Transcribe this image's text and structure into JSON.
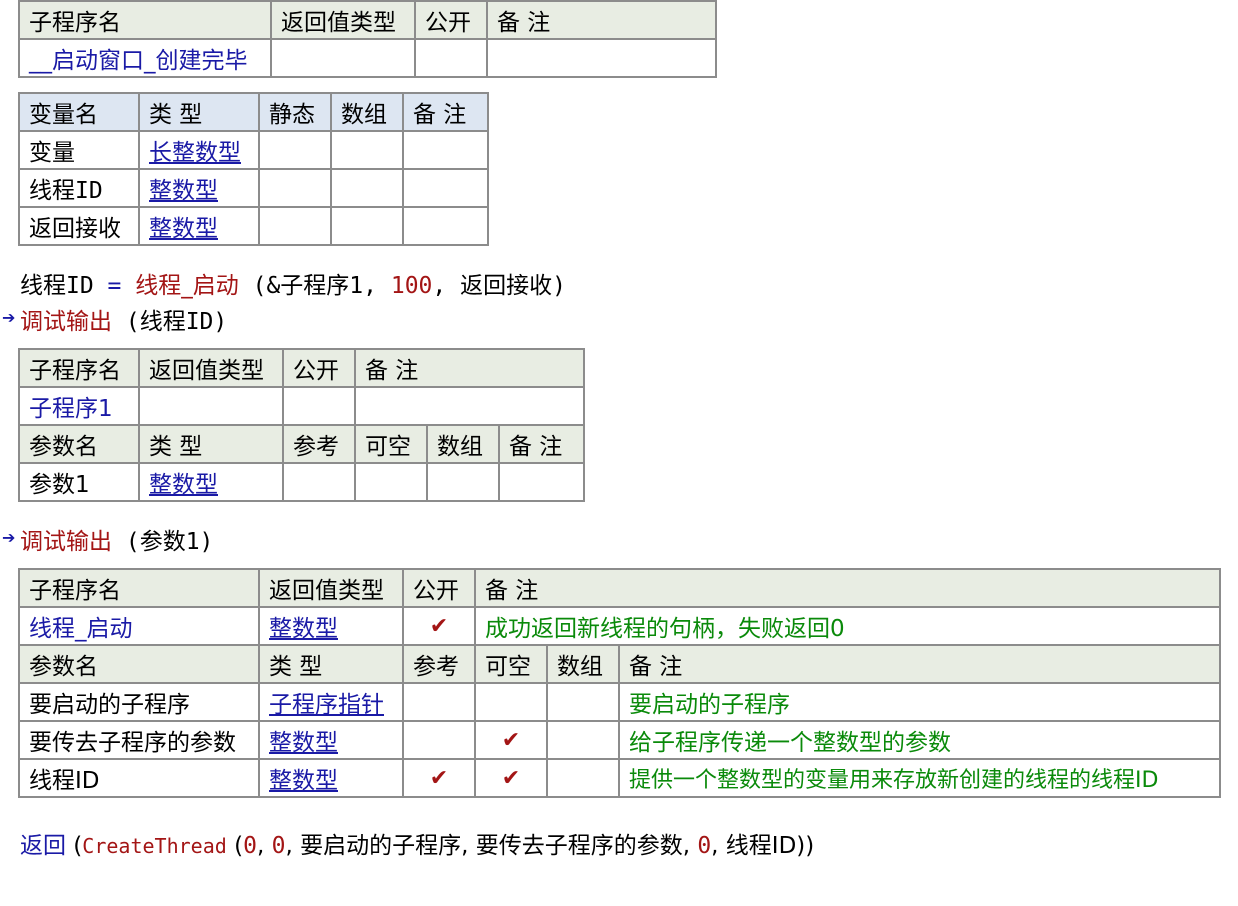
{
  "t1": {
    "headers": [
      "子程序名",
      "返回值类型",
      "公开",
      "备 注"
    ],
    "row": [
      "__启动窗口_创建完毕",
      "",
      "",
      ""
    ]
  },
  "t2": {
    "headers": [
      "变量名",
      "类 型",
      "静态",
      "数组",
      "备 注"
    ],
    "rows": [
      [
        "变量",
        "长整数型"
      ],
      [
        "线程ID",
        "整数型"
      ],
      [
        "返回接收",
        "整数型"
      ]
    ]
  },
  "code1": {
    "lhs": "线程ID",
    "op": " = ",
    "func": "线程_启动",
    "args_open": " (",
    "arg1": "&子程序1",
    "sep1": ", ",
    "arg2": "100",
    "sep2": ", ",
    "arg3": "返回接收",
    "args_close": ")"
  },
  "code2": {
    "func": "调试输出",
    "args": " (线程ID)"
  },
  "t3": {
    "headers": [
      "子程序名",
      "返回值类型",
      "公开",
      "备 注"
    ],
    "row": [
      "子程序1"
    ],
    "param_headers": [
      "参数名",
      "类 型",
      "参考",
      "可空",
      "数组",
      "备 注"
    ],
    "param_row": [
      "参数1",
      "整数型"
    ]
  },
  "code3": {
    "func": "调试输出",
    "args": " (参数1)"
  },
  "t4": {
    "headers": [
      "子程序名",
      "返回值类型",
      "公开",
      "备 注"
    ],
    "row": [
      "线程_启动",
      "整数型",
      "✔",
      "成功返回新线程的句柄，失败返回0"
    ],
    "param_headers": [
      "参数名",
      "类 型",
      "参考",
      "可空",
      "数组",
      "备 注"
    ],
    "params": [
      {
        "name": "要启动的子程序",
        "type": "子程序指针",
        "ref": "",
        "nullable": "",
        "note": "要启动的子程序"
      },
      {
        "name": "要传去子程序的参数",
        "type": "整数型",
        "ref": "",
        "nullable": "✔",
        "note": "给子程序传递一个整数型的参数"
      },
      {
        "name": "线程ID",
        "type": "整数型",
        "ref": "✔",
        "nullable": "✔",
        "note": "提供一个整数型的变量用来存放新创建的线程的线程ID"
      }
    ]
  },
  "code4": {
    "kw": "返回",
    "open": " (",
    "func": "CreateThread",
    "inner_open": " (",
    "a1": "0",
    "s1": ", ",
    "a2": "0",
    "s2": ", ",
    "a3": "要启动的子程序",
    "s3": ", ",
    "a4": "要传去子程序的参数",
    "s4": ", ",
    "a5": "0",
    "s5": ", ",
    "a6": "线程ID",
    "close": "))"
  }
}
